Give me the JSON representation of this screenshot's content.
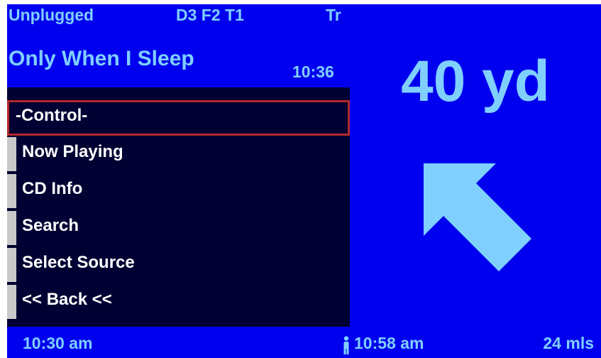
{
  "header": {
    "album": "Unplugged",
    "track_code": "D3 F2 T1",
    "mode": "Tr",
    "song_title": "Only When I Sleep",
    "elapsed": "10:36"
  },
  "menu": {
    "items": [
      {
        "label": "-Control-",
        "selected": true
      },
      {
        "label": "Now Playing"
      },
      {
        "label": "CD Info"
      },
      {
        "label": "Search"
      },
      {
        "label": "Select Source"
      },
      {
        "label": "<< Back <<"
      }
    ]
  },
  "navigation": {
    "distance": "40 yd",
    "direction_icon": "arrow-up-left-icon"
  },
  "status_bar": {
    "clock": "10:30 am",
    "eta_icon": "walker-icon",
    "eta": "10:58 am",
    "remaining": "24 mls"
  },
  "colors": {
    "panel_blue": "#0000ee",
    "menu_background": "#000033",
    "accent_text": "#7fcfff",
    "selection_border": "#b4282b",
    "menu_tab": "#c9c9c9"
  }
}
